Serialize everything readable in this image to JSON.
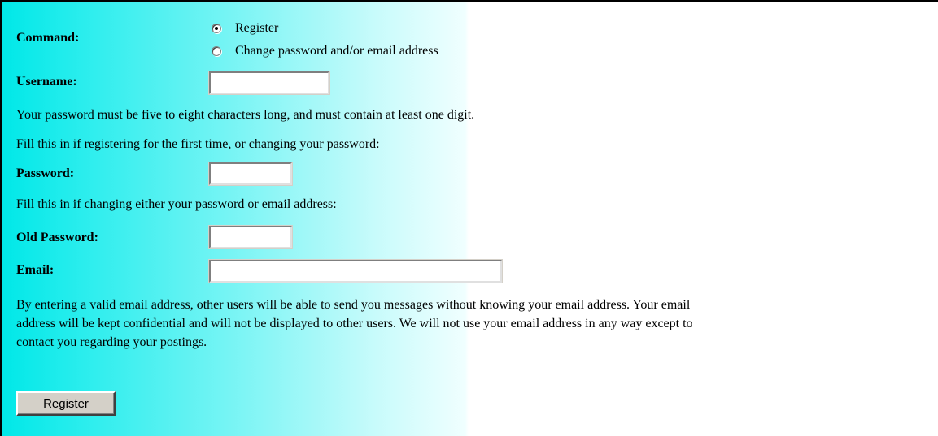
{
  "form": {
    "command_label": "Command:",
    "command_options": [
      {
        "label": "Register",
        "selected": true
      },
      {
        "label": "Change password and/or email address",
        "selected": false
      }
    ],
    "username_label": "Username:",
    "username_value": "",
    "password_rule_text": "Your password must be five to eight characters long, and must contain at least one digit.",
    "password_hint": "Fill this in if registering for the first time, or changing your password:",
    "password_label": "Password:",
    "password_value": "",
    "old_password_hint": "Fill this in if changing either your password or email address:",
    "old_password_label": "Old Password:",
    "old_password_value": "",
    "email_label": "Email:",
    "email_value": "",
    "email_note": "By entering a valid email address, other users will be able to send you messages without knowing your email address. Your email address will be kept confidential and will not be displayed to other users. We will not use your email address in any way except to contact you regarding your postings.",
    "submit_label": "Register"
  },
  "colors": {
    "gradient_start": "#00e8e8",
    "gradient_end": "#f0ffff",
    "button_face": "#d4d0c8"
  }
}
